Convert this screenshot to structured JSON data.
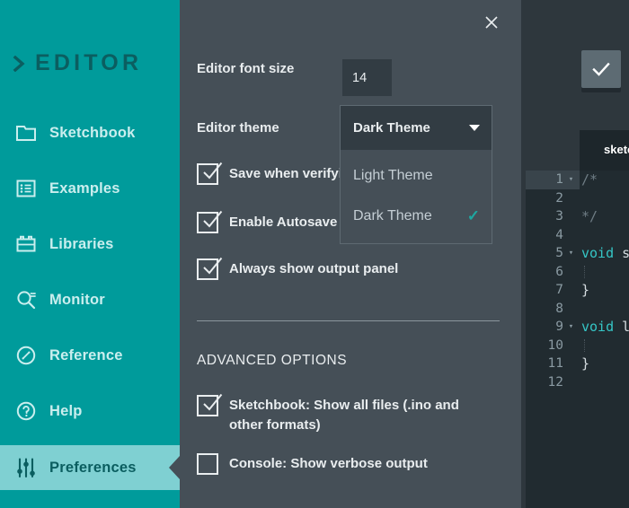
{
  "sidebar": {
    "brand": {
      "text": "EDITOR",
      "icon": "chevron-right-icon"
    },
    "items": [
      {
        "label": "Sketchbook",
        "icon": "folder-icon",
        "selected": false
      },
      {
        "label": "Examples",
        "icon": "list-icon",
        "selected": false
      },
      {
        "label": "Libraries",
        "icon": "library-icon",
        "selected": false
      },
      {
        "label": "Monitor",
        "icon": "monitor-search-icon",
        "selected": false
      },
      {
        "label": "Reference",
        "icon": "compass-icon",
        "selected": false
      },
      {
        "label": "Help",
        "icon": "question-circle-icon",
        "selected": false
      },
      {
        "label": "Preferences",
        "icon": "sliders-icon",
        "selected": true
      }
    ]
  },
  "preferences": {
    "close_label": "×",
    "font_size": {
      "label": "Editor font size",
      "value": "14",
      "placeholder": "14"
    },
    "theme": {
      "label": "Editor theme",
      "selected": "Dark Theme",
      "caret": "chevron-down-icon",
      "options": [
        {
          "label": "Light Theme",
          "checked": false,
          "check_glyph": ""
        },
        {
          "label": "Dark Theme",
          "checked": true,
          "check_glyph": "✓"
        }
      ]
    },
    "checkboxes": [
      {
        "label": "Save when verifying or uploading",
        "checked": true
      },
      {
        "label": "Enable Autosave",
        "checked": true
      },
      {
        "label": "Always show output panel",
        "checked": true
      }
    ],
    "advanced": {
      "title": "ADVANCED OPTIONS",
      "checkboxes": [
        {
          "label": "Sketchbook: Show all files (.ino and other formats)",
          "checked": true
        },
        {
          "label": "Console: Show verbose output",
          "checked": false
        }
      ]
    }
  },
  "editor": {
    "verify_button": {
      "icon": "checkmark-icon",
      "label": ""
    },
    "tab_label": "sketch",
    "gutter": [
      {
        "num": "1",
        "fold": "▾",
        "active": true
      },
      {
        "num": "2",
        "fold": "",
        "active": false
      },
      {
        "num": "3",
        "fold": "",
        "active": false
      },
      {
        "num": "4",
        "fold": "",
        "active": false
      },
      {
        "num": "5",
        "fold": "▾",
        "active": false
      },
      {
        "num": "6",
        "fold": "",
        "active": false
      },
      {
        "num": "7",
        "fold": "",
        "active": false
      },
      {
        "num": "8",
        "fold": "",
        "active": false
      },
      {
        "num": "9",
        "fold": "▾",
        "active": false
      },
      {
        "num": "10",
        "fold": "",
        "active": false
      },
      {
        "num": "11",
        "fold": "",
        "active": false
      },
      {
        "num": "12",
        "fold": "",
        "active": false
      }
    ],
    "code": [
      "/*",
      "",
      "*/",
      "",
      "void s",
      "",
      "}",
      "",
      "void l",
      "",
      "}",
      ""
    ]
  },
  "colors": {
    "sidebar_bg": "#009b9b",
    "sidebar_selected_bg": "#7fd0d2",
    "panel_bg": "#454f57",
    "input_bg": "#323c43",
    "editor_bg": "#212b30",
    "tab_bg": "#1d262b",
    "accent_check": "#1ea7a0",
    "keyword": "#35c6c6"
  }
}
